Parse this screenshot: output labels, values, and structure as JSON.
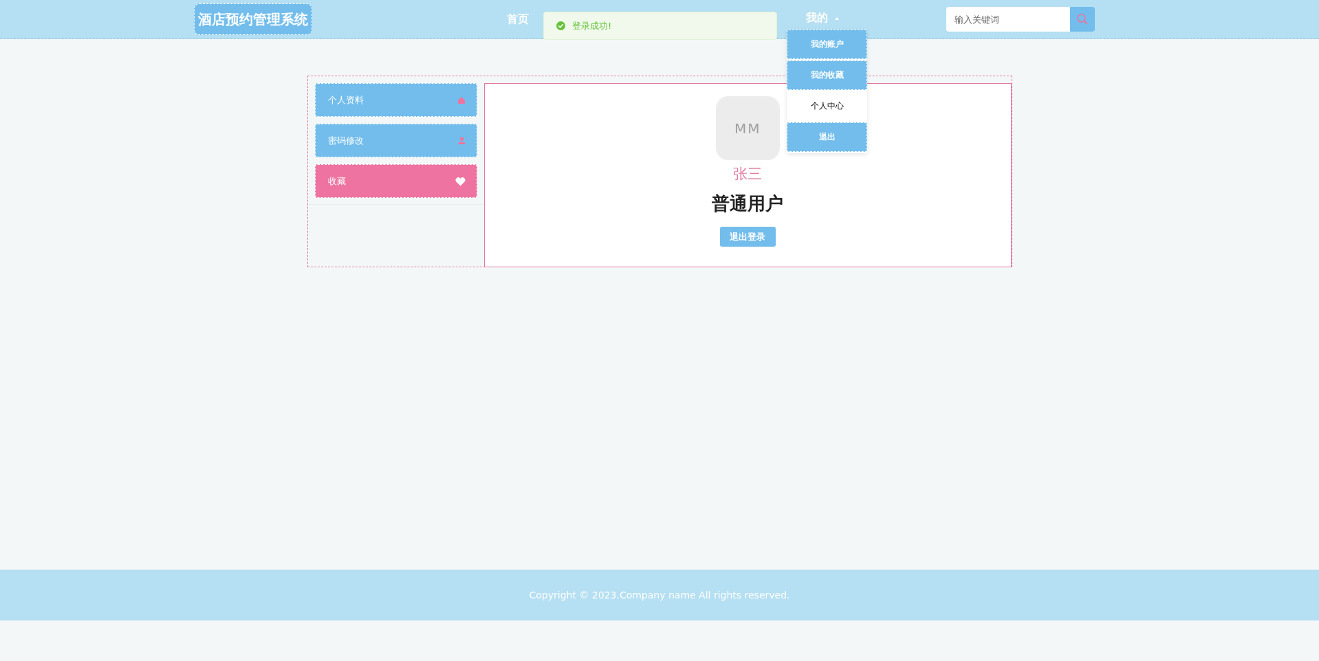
{
  "header": {
    "logo": "酒店预约管理系统",
    "nav": [
      {
        "label": "首页"
      }
    ],
    "user_menu": {
      "label": "我的",
      "expanded": true,
      "items": [
        {
          "label": "我的账户",
          "selected": false
        },
        {
          "label": "我的收藏",
          "selected": false
        },
        {
          "label": "个人中心",
          "selected": true
        },
        {
          "label": "退出",
          "selected": false
        }
      ]
    },
    "search": {
      "placeholder": "输入关键词"
    }
  },
  "toast": {
    "kind": "success",
    "message": "登录成功!"
  },
  "sidebar": {
    "items": [
      {
        "label": "个人资料",
        "kind": "home",
        "selected": false
      },
      {
        "label": "密码修改",
        "kind": "user",
        "selected": false
      },
      {
        "label": "收藏",
        "kind": "heart",
        "selected": true
      }
    ]
  },
  "profile": {
    "avatar_initials": "MM",
    "name": "张三",
    "role": "普通用户",
    "logout_button": "退出登录"
  },
  "footer": {
    "copyright": "Copyright © 2023.Company name All rights reserved."
  }
}
